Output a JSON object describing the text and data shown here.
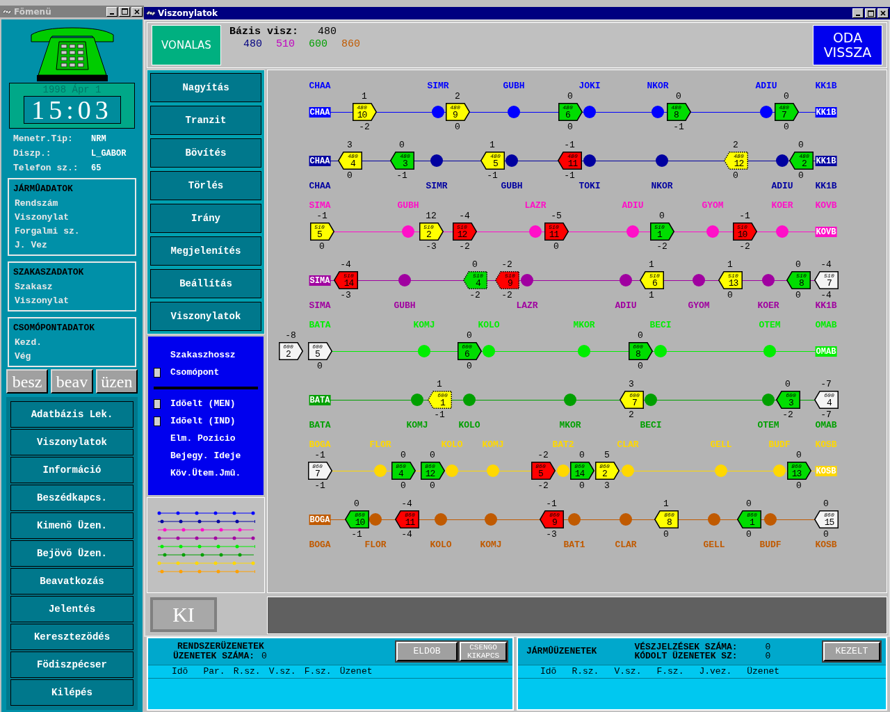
{
  "main_menu_window": {
    "title": "Fömenü",
    "date": "1998 Ápr 1",
    "time": "15:03",
    "info": [
      {
        "label": "Menetr.Tip:",
        "value": "NRM"
      },
      {
        "label": "Diszp.:",
        "value": "L_GABOR"
      },
      {
        "label": "Telefon sz.:",
        "value": "65"
      }
    ],
    "groups": [
      {
        "title": "JÁRMÛADATOK",
        "fields": [
          "Rendszám",
          "Viszonylat",
          "Forgalmi sz.",
          "J. Vez"
        ]
      },
      {
        "title": "SZAKASZADATOK",
        "fields": [
          "Szakasz",
          "Viszonylat"
        ]
      },
      {
        "title": "CSOMÓPONTADATOK",
        "fields": [
          "Kezd.",
          "Vég"
        ]
      }
    ],
    "mode_buttons": [
      "besz",
      "beav",
      "üzen"
    ],
    "menu": [
      "Adatbázis Lek.",
      "Viszonylatok",
      "Információ",
      "Beszédkapcs.",
      "Kimenö Üzen.",
      "Bejövö Üzen.",
      "Beavatkozás",
      "Jelentés",
      "Keresztezödés",
      "Födiszpécser",
      "Kilépés"
    ]
  },
  "routes_window": {
    "title": "Viszonylatok",
    "view_button": "VONALAS",
    "base_label": "Bázis visz:",
    "base_value": "480",
    "routes": [
      {
        "label": "480",
        "color": "#000080"
      },
      {
        "label": "510",
        "color": "#c000c0"
      },
      {
        "label": "600",
        "color": "#00a000"
      },
      {
        "label": "860",
        "color": "#c05a00"
      }
    ],
    "direction_button": "ODA VISSZA",
    "tools": [
      "Nagyítás",
      "Tranzit",
      "Bövítés",
      "Törlés",
      "Irány",
      "Megjelenítés",
      "Beállítás",
      "Viszonylatok"
    ],
    "options": [
      {
        "kind": "plain",
        "label": "Szakaszhossz"
      },
      {
        "kind": "checkbox",
        "label": "Csomópont",
        "checked": false
      },
      {
        "kind": "divider"
      },
      {
        "kind": "checkbox",
        "label": "Idõelt (MEN)",
        "checked": false
      },
      {
        "kind": "checkbox",
        "label": "Idõelt (IND)",
        "checked": false
      },
      {
        "kind": "plain",
        "label": "Elm. Pozicio"
      },
      {
        "kind": "plain",
        "label": "Bejegy. Ideje"
      },
      {
        "kind": "plain",
        "label": "Köv.Ütem.Jmû."
      }
    ],
    "exit_button": "KI",
    "lines": [
      {
        "color": "#0000ff",
        "kind": "outbound",
        "stations": [
          {
            "kind": "terminal",
            "name": "CHAA",
            "box_label": "CHAA"
          },
          {
            "kind": "stop",
            "name": "SIMR"
          },
          {
            "kind": "stop",
            "name": "GUBH"
          },
          {
            "kind": "stop",
            "name": "JOKI"
          },
          {
            "kind": "stop",
            "name": "NKOR"
          },
          {
            "kind": "stop",
            "name": "ADIU"
          },
          {
            "kind": "terminal",
            "name": "KK1B",
            "box_label": "KK1B"
          }
        ],
        "vehicles": [
          {
            "route": "480",
            "number": "10",
            "color": "#ffff00",
            "dotted": false,
            "above": "1",
            "below": "-2"
          },
          {
            "route": "480",
            "number": "9",
            "color": "#ffff00",
            "dotted": false,
            "above": "2",
            "below": "0"
          },
          {
            "route": "480",
            "number": "6",
            "color": "#00dd00",
            "dotted": false,
            "above": "0",
            "below": "0"
          },
          {
            "route": "480",
            "number": "8",
            "color": "#00dd00",
            "dotted": false,
            "above": "0",
            "below": "-1"
          },
          {
            "route": "480",
            "number": "7",
            "color": "#00dd00",
            "dotted": false,
            "above": "0",
            "below": "0"
          }
        ]
      },
      {
        "color": "#0000a0",
        "kind": "inbound",
        "stations": [
          {
            "kind": "terminal",
            "name": "CHAA",
            "box_label": "CHAA"
          },
          {
            "kind": "stop",
            "name": "SIMR"
          },
          {
            "kind": "stop",
            "name": "GUBH"
          },
          {
            "kind": "stop",
            "name": "TOKI"
          },
          {
            "kind": "stop",
            "name": "NKOR"
          },
          {
            "kind": "stop",
            "name": "ADIU"
          },
          {
            "kind": "terminal",
            "name": "KK1B",
            "box_label": "KK1B"
          }
        ],
        "vehicles": [
          {
            "route": "480",
            "number": "4",
            "color": "#ffff00",
            "dotted": false,
            "above": "3",
            "below": "0"
          },
          {
            "route": "480",
            "number": "3",
            "color": "#00dd00",
            "dotted": false,
            "above": "0",
            "below": "-1"
          },
          {
            "route": "480",
            "number": "5",
            "color": "#ffff00",
            "dotted": false,
            "above": "1",
            "below": "-1"
          },
          {
            "route": "480",
            "number": "11",
            "color": "#ff0000",
            "dotted": false,
            "above": "-1",
            "below": "-1"
          },
          {
            "route": "480",
            "number": "12",
            "color": "#ffff00",
            "dotted": true,
            "above": "2",
            "below": "0"
          },
          {
            "route": "480",
            "number": "2",
            "color": "#00dd00",
            "dotted": false,
            "above": "0",
            "below": "0"
          }
        ]
      },
      {
        "color": "#ff10c8",
        "kind": "outbound",
        "stations": [
          {
            "kind": "terminal",
            "name": "SIMA"
          },
          {
            "kind": "stop",
            "name": "GUBH"
          },
          {
            "kind": "stop",
            "name": "LAZR"
          },
          {
            "kind": "stop",
            "name": "ADIU"
          },
          {
            "kind": "stop",
            "name": "GYOM"
          },
          {
            "kind": "stop",
            "name": "KOER"
          },
          {
            "kind": "terminal",
            "name": "KOVB",
            "box_label": "KOVB"
          }
        ],
        "vehicles": [
          {
            "route": "510",
            "number": "5",
            "color": "#ffff00",
            "dotted": false,
            "above": "-1",
            "below": "0"
          },
          {
            "route": "510",
            "number": "2",
            "color": "#ffff00",
            "dotted": false,
            "above": "12",
            "below": "-3"
          },
          {
            "route": "510",
            "number": "12",
            "color": "#ff0000",
            "dotted": false,
            "above": "-4",
            "below": "-2"
          },
          {
            "route": "510",
            "number": "11",
            "color": "#ff0000",
            "dotted": false,
            "above": "-5",
            "below": "0"
          },
          {
            "route": "510",
            "number": "1",
            "color": "#00dd00",
            "dotted": false,
            "above": "0",
            "below": "-2"
          },
          {
            "route": "510",
            "number": "10",
            "color": "#ff0000",
            "dotted": false,
            "above": "-1",
            "below": "-2"
          }
        ]
      },
      {
        "color": "#a000a0",
        "kind": "inbound",
        "stations": [
          {
            "kind": "terminal",
            "name": "SIMA",
            "box_label": "SIMA"
          },
          {
            "kind": "stop",
            "name": "GUBH"
          },
          {
            "kind": "stop",
            "name": "LAZR"
          },
          {
            "kind": "stop",
            "name": "ADIU"
          },
          {
            "kind": "stop",
            "name": "GYOM"
          },
          {
            "kind": "stop",
            "name": "KOER"
          },
          {
            "kind": "terminal",
            "name": "KK1B"
          }
        ],
        "vehicles": [
          {
            "route": "510",
            "number": "14",
            "color": "#ff0000",
            "dotted": false,
            "above": "-4",
            "below": "-3"
          },
          {
            "route": "510",
            "number": "4",
            "color": "#00dd00",
            "dotted": true,
            "above": "0",
            "below": "-2"
          },
          {
            "route": "510",
            "number": "9",
            "color": "#ff0000",
            "dotted": true,
            "above": "-2",
            "below": "-2"
          },
          {
            "route": "510",
            "number": "6",
            "color": "#ffff00",
            "dotted": false,
            "above": "1",
            "below": "1"
          },
          {
            "route": "510",
            "number": "13",
            "color": "#ffff00",
            "dotted": false,
            "above": "1",
            "below": "0"
          },
          {
            "route": "510",
            "number": "8",
            "color": "#00dd00",
            "dotted": false,
            "above": "0",
            "below": "0"
          },
          {
            "route": "510",
            "number": "7",
            "color": "#f4f4f4",
            "dotted": false,
            "above": "-4",
            "below": "-4"
          }
        ]
      },
      {
        "color": "#00ee00",
        "kind": "outbound",
        "stations": [
          {
            "kind": "terminal",
            "name": "BATA"
          },
          {
            "kind": "stop",
            "name": "KOMJ"
          },
          {
            "kind": "stop",
            "name": "KOLO"
          },
          {
            "kind": "stop",
            "name": "MKOR"
          },
          {
            "kind": "stop",
            "name": "BECI"
          },
          {
            "kind": "stop",
            "name": "OTEM"
          },
          {
            "kind": "terminal",
            "name": "OMAB",
            "box_label": "OMAB"
          }
        ],
        "vehicles": [
          {
            "route": "600",
            "number": "2",
            "color": "#f4f4f4",
            "dotted": false,
            "above": "-8"
          },
          {
            "route": "600",
            "number": "5",
            "color": "#f4f4f4",
            "dotted": false,
            "below": "0"
          },
          {
            "route": "600",
            "number": "6",
            "color": "#00dd00",
            "dotted": false,
            "above": "0",
            "below": "0"
          },
          {
            "route": "600",
            "number": "8",
            "color": "#00dd00",
            "dotted": false,
            "above": "0",
            "below": "0"
          }
        ]
      },
      {
        "color": "#00a000",
        "kind": "inbound",
        "stations": [
          {
            "kind": "terminal",
            "name": "BATA",
            "box_label": "BATA"
          },
          {
            "kind": "stop",
            "name": "KOMJ"
          },
          {
            "kind": "stop",
            "name": "KOLO"
          },
          {
            "kind": "stop",
            "name": "MKOR"
          },
          {
            "kind": "stop",
            "name": "BECI"
          },
          {
            "kind": "stop",
            "name": "OTEM"
          },
          {
            "kind": "terminal",
            "name": "OMAB"
          }
        ],
        "vehicles": [
          {
            "route": "600",
            "number": "1",
            "color": "#ffff00",
            "dotted": true,
            "above": "1",
            "below": "-1"
          },
          {
            "route": "600",
            "number": "7",
            "color": "#ffff00",
            "dotted": false,
            "above": "3",
            "below": "2"
          },
          {
            "route": "600",
            "number": "3",
            "color": "#00dd00",
            "dotted": false,
            "above": "0",
            "below": "-2"
          },
          {
            "route": "600",
            "number": "4",
            "color": "#f4f4f4",
            "dotted": false,
            "above": "-7",
            "below": "-7"
          }
        ]
      },
      {
        "color": "#ffd800",
        "kind": "outbound",
        "stations": [
          {
            "kind": "terminal",
            "name": "BOGA"
          },
          {
            "kind": "stop",
            "name": "FLOR"
          },
          {
            "kind": "stop",
            "name": "KOLO"
          },
          {
            "kind": "stop",
            "name": "KOMJ"
          },
          {
            "kind": "stop",
            "name": "BAT2"
          },
          {
            "kind": "stop",
            "name": "CLAR"
          },
          {
            "kind": "stop",
            "name": "GELL"
          },
          {
            "kind": "stop",
            "name": "BUDF"
          },
          {
            "kind": "terminal",
            "name": "KOSB",
            "box_label": "KOSB"
          }
        ],
        "vehicles": [
          {
            "route": "860",
            "number": "7",
            "color": "#f4f4f4",
            "dotted": false,
            "above": "-1",
            "below": "-1"
          },
          {
            "route": "860",
            "number": "4",
            "color": "#00dd00",
            "dotted": false,
            "above": "0",
            "below": "0"
          },
          {
            "route": "860",
            "number": "12",
            "color": "#00dd00",
            "dotted": false,
            "above": "0",
            "below": "0"
          },
          {
            "route": "860",
            "number": "5",
            "color": "#ff0000",
            "dotted": false,
            "above": "-2",
            "below": "-2"
          },
          {
            "route": "860",
            "number": "14",
            "color": "#00dd00",
            "dotted": false,
            "above": "0",
            "below": "0"
          },
          {
            "route": "860",
            "number": "2",
            "color": "#ffff00",
            "dotted": false,
            "above": "5",
            "below": "3"
          },
          {
            "route": "860",
            "number": "13",
            "color": "#00dd00",
            "dotted": false,
            "above": "0",
            "below": "0"
          }
        ]
      },
      {
        "color": "#c05a00",
        "kind": "inbound",
        "stations": [
          {
            "kind": "terminal",
            "name": "BOGA",
            "box_label": "BOGA"
          },
          {
            "kind": "stop",
            "name": "FLOR"
          },
          {
            "kind": "stop",
            "name": "KOLO"
          },
          {
            "kind": "stop",
            "name": "KOMJ"
          },
          {
            "kind": "stop",
            "name": "BAT1"
          },
          {
            "kind": "stop",
            "name": "CLAR"
          },
          {
            "kind": "stop",
            "name": "GELL"
          },
          {
            "kind": "stop",
            "name": "BUDF"
          },
          {
            "kind": "terminal",
            "name": "KOSB"
          }
        ],
        "vehicles": [
          {
            "route": "860",
            "number": "10",
            "color": "#00dd00",
            "dotted": false,
            "above": "0",
            "below": "-1"
          },
          {
            "route": "860",
            "number": "11",
            "color": "#ff0000",
            "dotted": false,
            "above": "-4",
            "below": "-4"
          },
          {
            "route": "860",
            "number": "9",
            "color": "#ff0000",
            "dotted": false,
            "above": "-1",
            "below": "-3"
          },
          {
            "route": "860",
            "number": "8",
            "color": "#ffff00",
            "dotted": false,
            "above": "1",
            "below": "0"
          },
          {
            "route": "860",
            "number": "1",
            "color": "#00dd00",
            "dotted": false,
            "above": "0",
            "below": "0"
          },
          {
            "route": "860",
            "number": "15",
            "color": "#f4f4f4",
            "dotted": false,
            "above": "0",
            "below": "0"
          }
        ]
      }
    ]
  },
  "system_messages": {
    "title": "RENDSZERÜZENETEK",
    "count_label": "ÜZENETEK SZÁMA:",
    "count": "0",
    "buttons": [
      "ELDOB",
      "CSENGO KIKAPCS"
    ],
    "columns": [
      "Idõ",
      "Par.",
      "R.sz.",
      "V.sz.",
      "F.sz.",
      "Üzenet"
    ]
  },
  "vehicle_messages": {
    "title": "JÁRMÛÜZENETEK",
    "counters": [
      {
        "label": "VÉSZJELZÉSEK SZÁMA:",
        "value": "0"
      },
      {
        "label": "KÓDOLT ÜZENETEK SZ:",
        "value": "0"
      }
    ],
    "button": "KEZELT",
    "columns": [
      "Idõ",
      "R.sz.",
      "V.sz.",
      "F.sz.",
      "J.vez.",
      "Üzenet"
    ]
  }
}
